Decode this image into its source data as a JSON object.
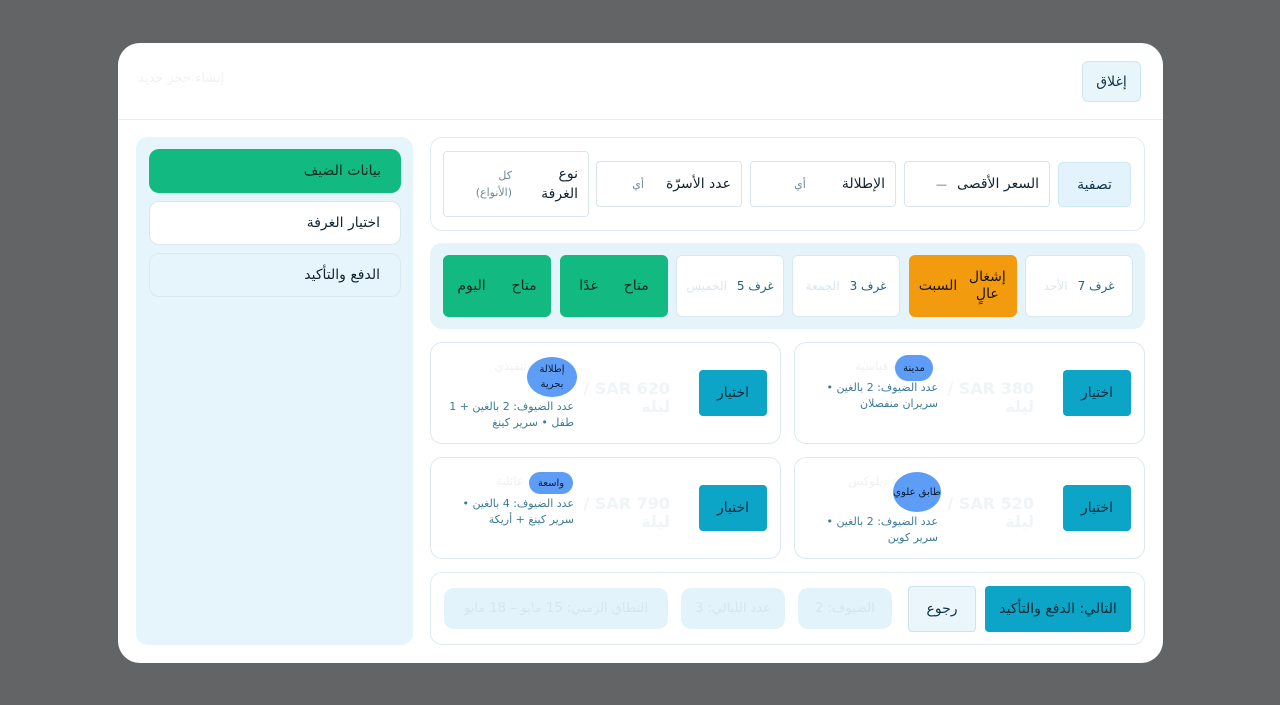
{
  "header": {
    "close_label": "إغلاق",
    "title": "إنشاء حجز جديد"
  },
  "steps": [
    {
      "label": "بيانات الضيف"
    },
    {
      "label": "اختيار الغرفة"
    },
    {
      "label": "الدفع والتأكيد"
    }
  ],
  "filters": {
    "title": "تصفية",
    "max_price": {
      "label": "السعر الأقصى",
      "value": "—"
    },
    "view": {
      "label": "الإطلالة",
      "value": "أي"
    },
    "beds": {
      "label": "عدد الأسرّة",
      "value": "أي"
    },
    "room_type": {
      "label": "نوع الغرفة",
      "value": "كل (الأنواع)"
    }
  },
  "dates": [
    {
      "label": "غرف 7",
      "day": "الأحد"
    },
    {
      "label": "إشغال عالٍ",
      "day": "السبت"
    },
    {
      "label": "غرف 3",
      "day": "الجمعة"
    },
    {
      "label": "غرف 5",
      "day": "الخميس"
    },
    {
      "label": "متاح",
      "day": "غدًا"
    },
    {
      "label": "متاح",
      "day": "اليوم"
    }
  ],
  "rooms": [
    {
      "select_label": "اختيار",
      "price": "SAR 380 / ليلة",
      "name": "غرفة قياسية",
      "badge": "مدينة",
      "details": "عدد الضيوف: 2 بالغين • سريران منفصلان"
    },
    {
      "select_label": "اختيار",
      "price": "SAR 620 / ليلة",
      "name": "جناح تنفيذي",
      "badge": "إطلالة بحرية",
      "details": "عدد الضيوف: 2 بالغين + 1 طفل • سرير كينغ"
    },
    {
      "select_label": "اختيار",
      "price": "SAR 520 / ليلة",
      "name": "غرفة ديلوكس",
      "badge": "طابق علوي",
      "details": "عدد الضيوف: 2 بالغين • سرير كوين"
    },
    {
      "select_label": "اختيار",
      "price": "SAR 790 / ليلة",
      "name": "غرفة عائلية",
      "badge": "واسعة",
      "details": "عدد الضيوف: 4 بالغين • سرير كينغ + أريكة"
    }
  ],
  "footer": {
    "next_label": "التالي: الدفع والتأكيد",
    "back_label": "رجوع",
    "guests": "الضيوف: 2",
    "nights": "عدد الليالي: 3",
    "range": "النطاق الزمني: 15 مايو – 18 مايو"
  },
  "colors": {
    "accent": "#0ca5c8",
    "success": "#12b981",
    "warning": "#f39b0f",
    "badge": "#5d9df5",
    "backdrop": "#636466"
  }
}
